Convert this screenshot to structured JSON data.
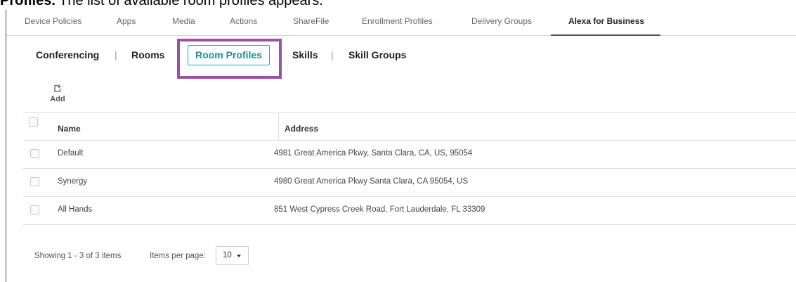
{
  "caption": {
    "bold": "Profiles.",
    "rest": " The list of available room profiles appears."
  },
  "top_tabs": [
    {
      "label": "Device Policies"
    },
    {
      "label": "Apps"
    },
    {
      "label": "Media"
    },
    {
      "label": "Actions"
    },
    {
      "label": "ShareFile"
    },
    {
      "label": "Enrollment Profiles"
    },
    {
      "label": "Delivery Groups"
    },
    {
      "label": "Alexa for Business"
    }
  ],
  "active_top_tab": "Alexa for Business",
  "sub_tabs": [
    {
      "label": "Conferencing"
    },
    {
      "label": "Rooms"
    },
    {
      "label": "Room Profiles"
    },
    {
      "label": "Skills"
    },
    {
      "label": "Skill Groups"
    }
  ],
  "separator": "|",
  "active_sub_tab": "Room Profiles",
  "toolbar": {
    "add_label": "Add",
    "add_icon": "add-page-icon"
  },
  "table": {
    "columns": [
      "Name",
      "Address"
    ],
    "rows": [
      {
        "name": "Default",
        "address": "4981 Great America Pkwy, Santa Clara, CA, US, 95054"
      },
      {
        "name": "Synergy",
        "address": "4980 Great America Pkwy Santa Clara, CA 95054, US"
      },
      {
        "name": "All Hands",
        "address": "851 West Cypress Creek Road, Fort Lauderdale, FL 33309"
      }
    ]
  },
  "pagination": {
    "showing": "Showing 1 - 3 of 3 items",
    "items_per_page_label": "Items per page:",
    "items_per_page_value": "10"
  },
  "colors": {
    "accent": "#1a8f92",
    "highlight_box": "#9b4fa5"
  }
}
